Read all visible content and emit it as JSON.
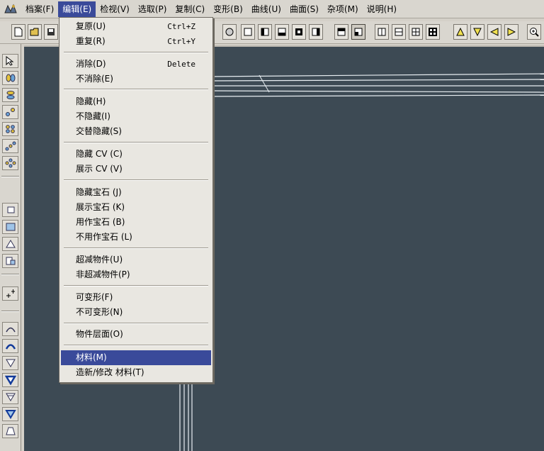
{
  "menubar": {
    "items": [
      {
        "label": "档案(F)"
      },
      {
        "label": "编辑(E)"
      },
      {
        "label": "检视(V)"
      },
      {
        "label": "选取(P)"
      },
      {
        "label": "复制(C)"
      },
      {
        "label": "变形(B)"
      },
      {
        "label": "曲线(U)"
      },
      {
        "label": "曲面(S)"
      },
      {
        "label": "杂项(M)"
      },
      {
        "label": "说明(H)"
      }
    ]
  },
  "edit_menu": {
    "items": [
      {
        "label": "复原(U)",
        "shortcut": "Ctrl+Z"
      },
      {
        "label": "重复(R)",
        "shortcut": "Ctrl+Y"
      },
      {
        "label": "消除(D)",
        "shortcut": "Delete"
      },
      {
        "label": "不消除(E)",
        "shortcut": ""
      },
      {
        "label": "隐藏(H)",
        "shortcut": ""
      },
      {
        "label": "不隐藏(I)",
        "shortcut": ""
      },
      {
        "label": "交替隐藏(S)",
        "shortcut": ""
      },
      {
        "label": "隐藏 CV (C)",
        "shortcut": ""
      },
      {
        "label": "展示 CV (V)",
        "shortcut": ""
      },
      {
        "label": "隐藏宝石 (J)",
        "shortcut": ""
      },
      {
        "label": "展示宝石 (K)",
        "shortcut": ""
      },
      {
        "label": "用作宝石 (B)",
        "shortcut": ""
      },
      {
        "label": "不用作宝石 (L)",
        "shortcut": ""
      },
      {
        "label": "超减物件(U)",
        "shortcut": ""
      },
      {
        "label": "非超减物件(P)",
        "shortcut": ""
      },
      {
        "label": "可变形(F)",
        "shortcut": ""
      },
      {
        "label": "不可变形(N)",
        "shortcut": ""
      },
      {
        "label": "物件层面(O)",
        "shortcut": ""
      },
      {
        "label": "材料(M)",
        "shortcut": ""
      },
      {
        "label": "造新/修改 材料(T)",
        "shortcut": ""
      }
    ],
    "highlighted_index": 18
  },
  "colors": {
    "viewport_bg": "#3d4a54",
    "highlight": "#3a4a9a",
    "menu_bg": "#e9e7e1",
    "curve": "#e8eef2"
  }
}
